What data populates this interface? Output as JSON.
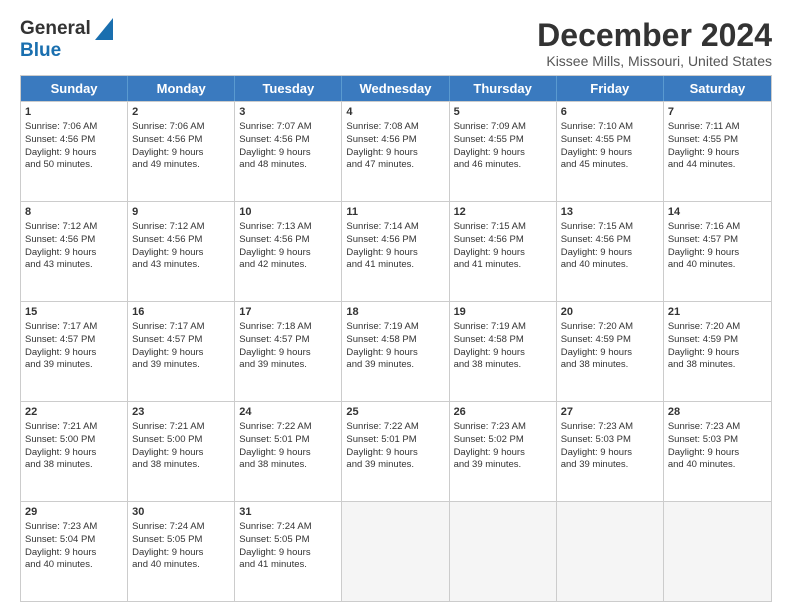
{
  "header": {
    "logo_general": "General",
    "logo_blue": "Blue",
    "month_title": "December 2024",
    "subtitle": "Kissee Mills, Missouri, United States"
  },
  "weekdays": [
    "Sunday",
    "Monday",
    "Tuesday",
    "Wednesday",
    "Thursday",
    "Friday",
    "Saturday"
  ],
  "weeks": [
    [
      {
        "day": "1",
        "lines": [
          "Sunrise: 7:06 AM",
          "Sunset: 4:56 PM",
          "Daylight: 9 hours",
          "and 50 minutes."
        ]
      },
      {
        "day": "2",
        "lines": [
          "Sunrise: 7:06 AM",
          "Sunset: 4:56 PM",
          "Daylight: 9 hours",
          "and 49 minutes."
        ]
      },
      {
        "day": "3",
        "lines": [
          "Sunrise: 7:07 AM",
          "Sunset: 4:56 PM",
          "Daylight: 9 hours",
          "and 48 minutes."
        ]
      },
      {
        "day": "4",
        "lines": [
          "Sunrise: 7:08 AM",
          "Sunset: 4:56 PM",
          "Daylight: 9 hours",
          "and 47 minutes."
        ]
      },
      {
        "day": "5",
        "lines": [
          "Sunrise: 7:09 AM",
          "Sunset: 4:55 PM",
          "Daylight: 9 hours",
          "and 46 minutes."
        ]
      },
      {
        "day": "6",
        "lines": [
          "Sunrise: 7:10 AM",
          "Sunset: 4:55 PM",
          "Daylight: 9 hours",
          "and 45 minutes."
        ]
      },
      {
        "day": "7",
        "lines": [
          "Sunrise: 7:11 AM",
          "Sunset: 4:55 PM",
          "Daylight: 9 hours",
          "and 44 minutes."
        ]
      }
    ],
    [
      {
        "day": "8",
        "lines": [
          "Sunrise: 7:12 AM",
          "Sunset: 4:56 PM",
          "Daylight: 9 hours",
          "and 43 minutes."
        ]
      },
      {
        "day": "9",
        "lines": [
          "Sunrise: 7:12 AM",
          "Sunset: 4:56 PM",
          "Daylight: 9 hours",
          "and 43 minutes."
        ]
      },
      {
        "day": "10",
        "lines": [
          "Sunrise: 7:13 AM",
          "Sunset: 4:56 PM",
          "Daylight: 9 hours",
          "and 42 minutes."
        ]
      },
      {
        "day": "11",
        "lines": [
          "Sunrise: 7:14 AM",
          "Sunset: 4:56 PM",
          "Daylight: 9 hours",
          "and 41 minutes."
        ]
      },
      {
        "day": "12",
        "lines": [
          "Sunrise: 7:15 AM",
          "Sunset: 4:56 PM",
          "Daylight: 9 hours",
          "and 41 minutes."
        ]
      },
      {
        "day": "13",
        "lines": [
          "Sunrise: 7:15 AM",
          "Sunset: 4:56 PM",
          "Daylight: 9 hours",
          "and 40 minutes."
        ]
      },
      {
        "day": "14",
        "lines": [
          "Sunrise: 7:16 AM",
          "Sunset: 4:57 PM",
          "Daylight: 9 hours",
          "and 40 minutes."
        ]
      }
    ],
    [
      {
        "day": "15",
        "lines": [
          "Sunrise: 7:17 AM",
          "Sunset: 4:57 PM",
          "Daylight: 9 hours",
          "and 39 minutes."
        ]
      },
      {
        "day": "16",
        "lines": [
          "Sunrise: 7:17 AM",
          "Sunset: 4:57 PM",
          "Daylight: 9 hours",
          "and 39 minutes."
        ]
      },
      {
        "day": "17",
        "lines": [
          "Sunrise: 7:18 AM",
          "Sunset: 4:57 PM",
          "Daylight: 9 hours",
          "and 39 minutes."
        ]
      },
      {
        "day": "18",
        "lines": [
          "Sunrise: 7:19 AM",
          "Sunset: 4:58 PM",
          "Daylight: 9 hours",
          "and 39 minutes."
        ]
      },
      {
        "day": "19",
        "lines": [
          "Sunrise: 7:19 AM",
          "Sunset: 4:58 PM",
          "Daylight: 9 hours",
          "and 38 minutes."
        ]
      },
      {
        "day": "20",
        "lines": [
          "Sunrise: 7:20 AM",
          "Sunset: 4:59 PM",
          "Daylight: 9 hours",
          "and 38 minutes."
        ]
      },
      {
        "day": "21",
        "lines": [
          "Sunrise: 7:20 AM",
          "Sunset: 4:59 PM",
          "Daylight: 9 hours",
          "and 38 minutes."
        ]
      }
    ],
    [
      {
        "day": "22",
        "lines": [
          "Sunrise: 7:21 AM",
          "Sunset: 5:00 PM",
          "Daylight: 9 hours",
          "and 38 minutes."
        ]
      },
      {
        "day": "23",
        "lines": [
          "Sunrise: 7:21 AM",
          "Sunset: 5:00 PM",
          "Daylight: 9 hours",
          "and 38 minutes."
        ]
      },
      {
        "day": "24",
        "lines": [
          "Sunrise: 7:22 AM",
          "Sunset: 5:01 PM",
          "Daylight: 9 hours",
          "and 38 minutes."
        ]
      },
      {
        "day": "25",
        "lines": [
          "Sunrise: 7:22 AM",
          "Sunset: 5:01 PM",
          "Daylight: 9 hours",
          "and 39 minutes."
        ]
      },
      {
        "day": "26",
        "lines": [
          "Sunrise: 7:23 AM",
          "Sunset: 5:02 PM",
          "Daylight: 9 hours",
          "and 39 minutes."
        ]
      },
      {
        "day": "27",
        "lines": [
          "Sunrise: 7:23 AM",
          "Sunset: 5:03 PM",
          "Daylight: 9 hours",
          "and 39 minutes."
        ]
      },
      {
        "day": "28",
        "lines": [
          "Sunrise: 7:23 AM",
          "Sunset: 5:03 PM",
          "Daylight: 9 hours",
          "and 40 minutes."
        ]
      }
    ],
    [
      {
        "day": "29",
        "lines": [
          "Sunrise: 7:23 AM",
          "Sunset: 5:04 PM",
          "Daylight: 9 hours",
          "and 40 minutes."
        ]
      },
      {
        "day": "30",
        "lines": [
          "Sunrise: 7:24 AM",
          "Sunset: 5:05 PM",
          "Daylight: 9 hours",
          "and 40 minutes."
        ]
      },
      {
        "day": "31",
        "lines": [
          "Sunrise: 7:24 AM",
          "Sunset: 5:05 PM",
          "Daylight: 9 hours",
          "and 41 minutes."
        ]
      },
      {
        "day": "",
        "lines": []
      },
      {
        "day": "",
        "lines": []
      },
      {
        "day": "",
        "lines": []
      },
      {
        "day": "",
        "lines": []
      }
    ]
  ]
}
